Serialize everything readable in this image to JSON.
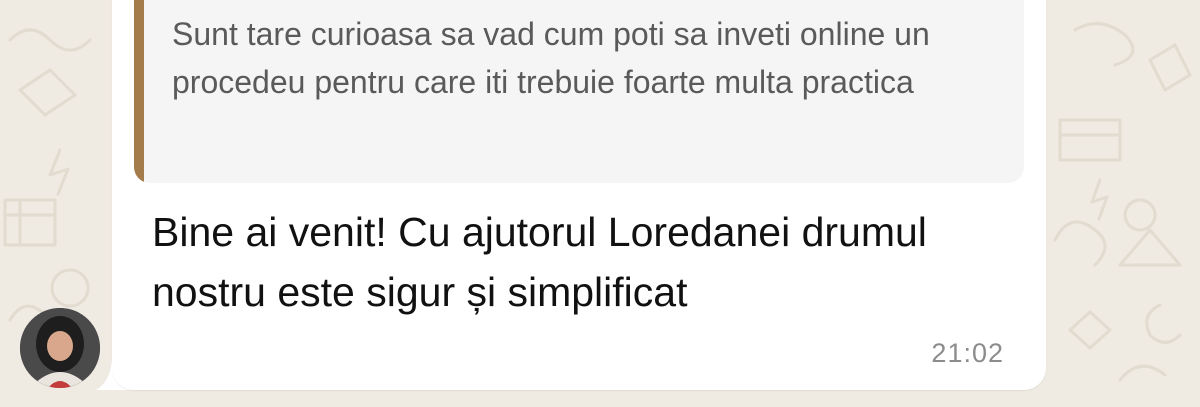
{
  "chat": {
    "quoted_message": {
      "text": "Sunt tare curioasa sa vad cum poti sa inveti online un procedeu pentru care iti trebuie foarte multa practica"
    },
    "message": {
      "text": "Bine ai venit! Cu ajutorul Loredanei drumul nostru este sigur și simplificat",
      "time": "21:02"
    },
    "sender_avatar": {
      "icon": "user-avatar-photo"
    }
  },
  "colors": {
    "wallpaper": "#efeae2",
    "bubble": "#ffffff",
    "quote_background": "#f5f5f5",
    "quote_accent": "#a47c4b",
    "timestamp": "#8c8c8c"
  }
}
